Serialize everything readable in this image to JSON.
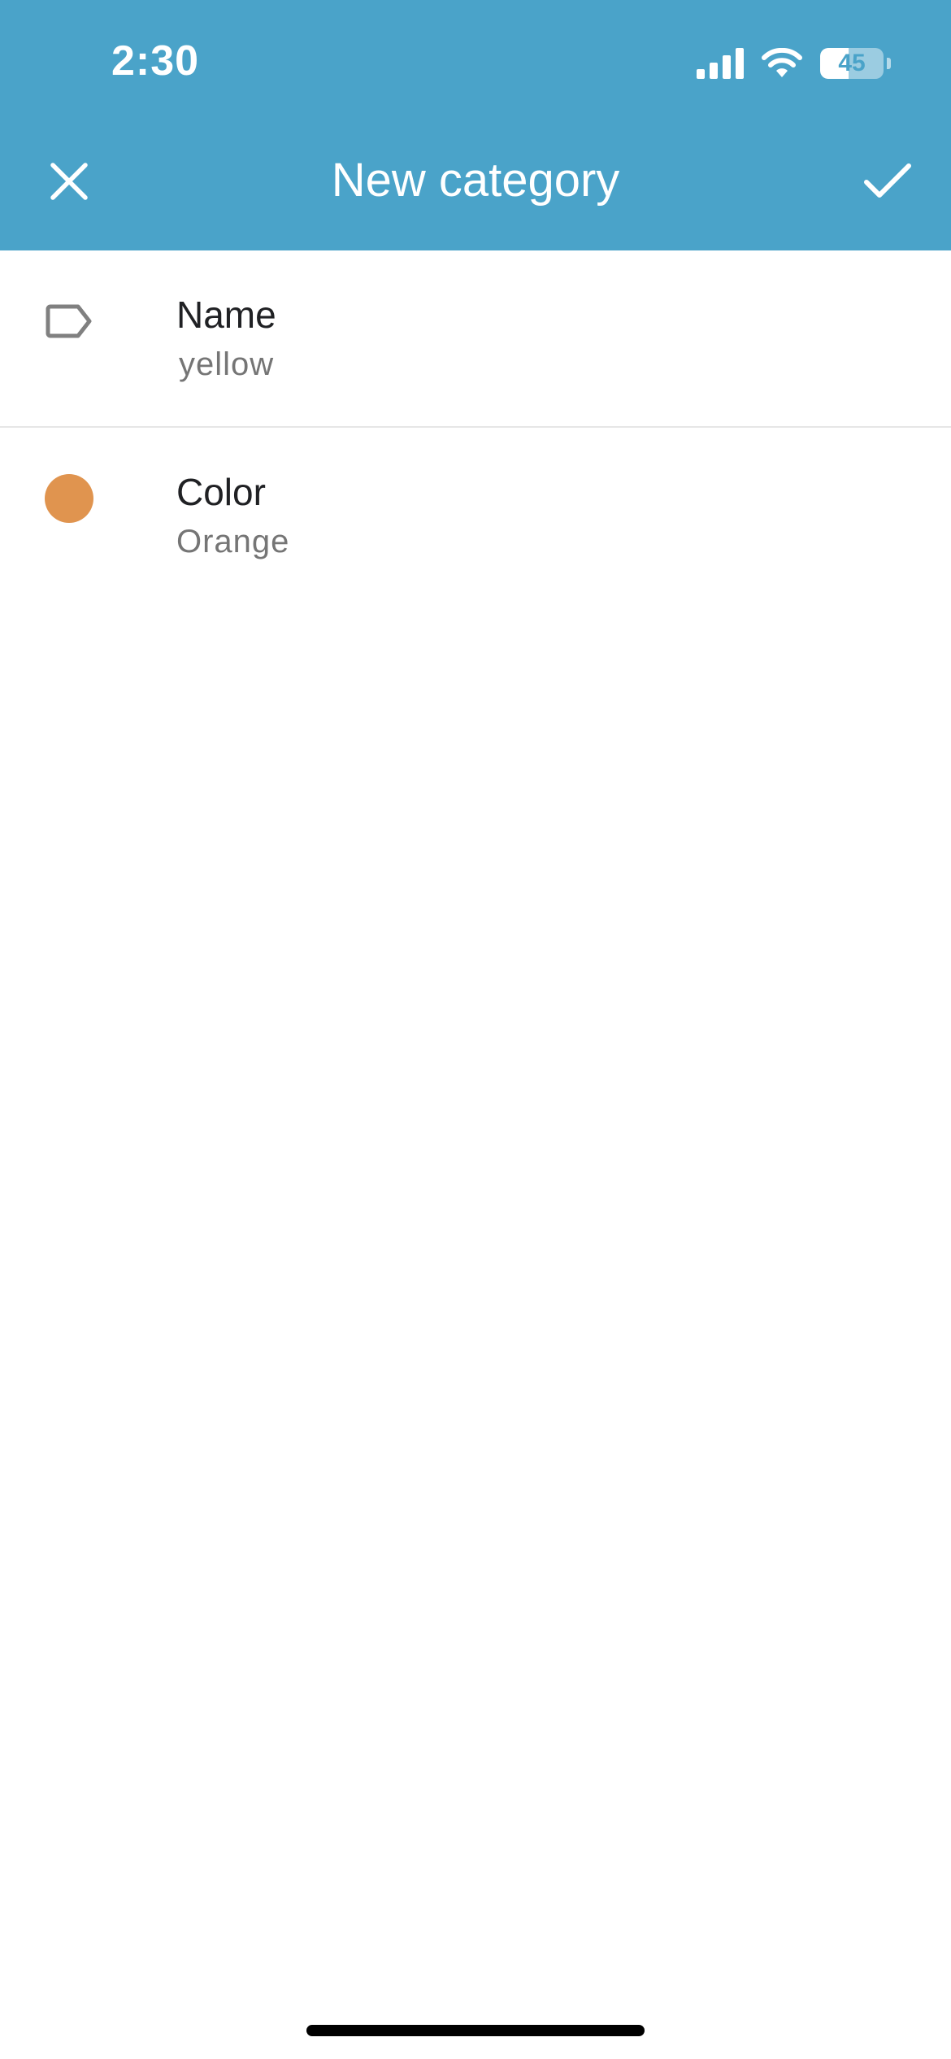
{
  "status_bar": {
    "time": "2:30",
    "battery_level": "45",
    "battery_fraction": 0.45
  },
  "app_bar": {
    "title": "New category",
    "close_icon": "close-icon",
    "confirm_icon": "check-icon"
  },
  "fields": {
    "name": {
      "label": "Name",
      "value": "yellow",
      "icon": "label-tag-icon"
    },
    "color": {
      "label": "Color",
      "value": "Orange",
      "swatch": "#e0944f"
    }
  },
  "colors": {
    "accent": "#4aa3c9",
    "icon_gray": "#808080"
  }
}
